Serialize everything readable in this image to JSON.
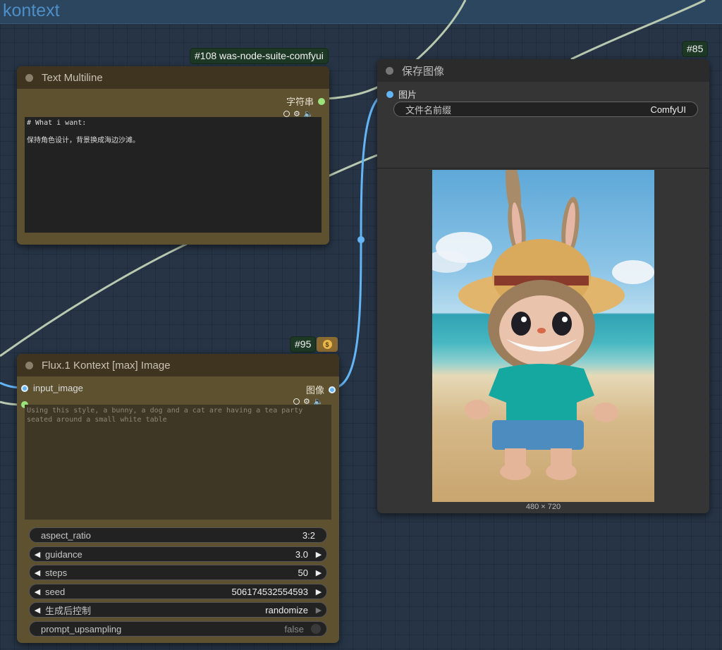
{
  "group": {
    "title": "kontext"
  },
  "nodes": {
    "text_multiline": {
      "badge": "#108 was-node-suite-comfyui",
      "title": "Text Multiline",
      "output_label": "字符串",
      "text": "# What i want:\n\n保持角色设计，背景换成海边沙滩。"
    },
    "save_image": {
      "badge": "#85",
      "title": "保存图像",
      "input_label": "图片",
      "filename_prefix": {
        "label": "文件名前缀",
        "value": "ComfyUI"
      },
      "image_size": "480 × 720"
    },
    "flux_kontext": {
      "badge": "#95",
      "title": "Flux.1 Kontext [max] Image",
      "input_label": "input_image",
      "output_label": "图像",
      "prompt": "Using this style, a bunny, a dog and a cat are having a tea party seated around a small white table",
      "widgets": {
        "aspect_ratio": {
          "label": "aspect_ratio",
          "value": "3:2"
        },
        "guidance": {
          "label": "guidance",
          "value": "3.0"
        },
        "steps": {
          "label": "steps",
          "value": "50"
        },
        "seed": {
          "label": "seed",
          "value": "506174532554593"
        },
        "control_after": {
          "label": "生成后控制",
          "value": "randomize"
        },
        "prompt_upsampling": {
          "label": "prompt_upsampling",
          "value": "false"
        }
      }
    }
  },
  "colors": {
    "canvas": "#263445",
    "node_brown": "#5e512f",
    "node_dark": "#353535",
    "link_image": "#64b5f6",
    "link_string": "#b8c9b0",
    "badge_bg": "#1e3826"
  },
  "icons": [
    "gear-icon",
    "speaker-icon",
    "coin-icon"
  ]
}
